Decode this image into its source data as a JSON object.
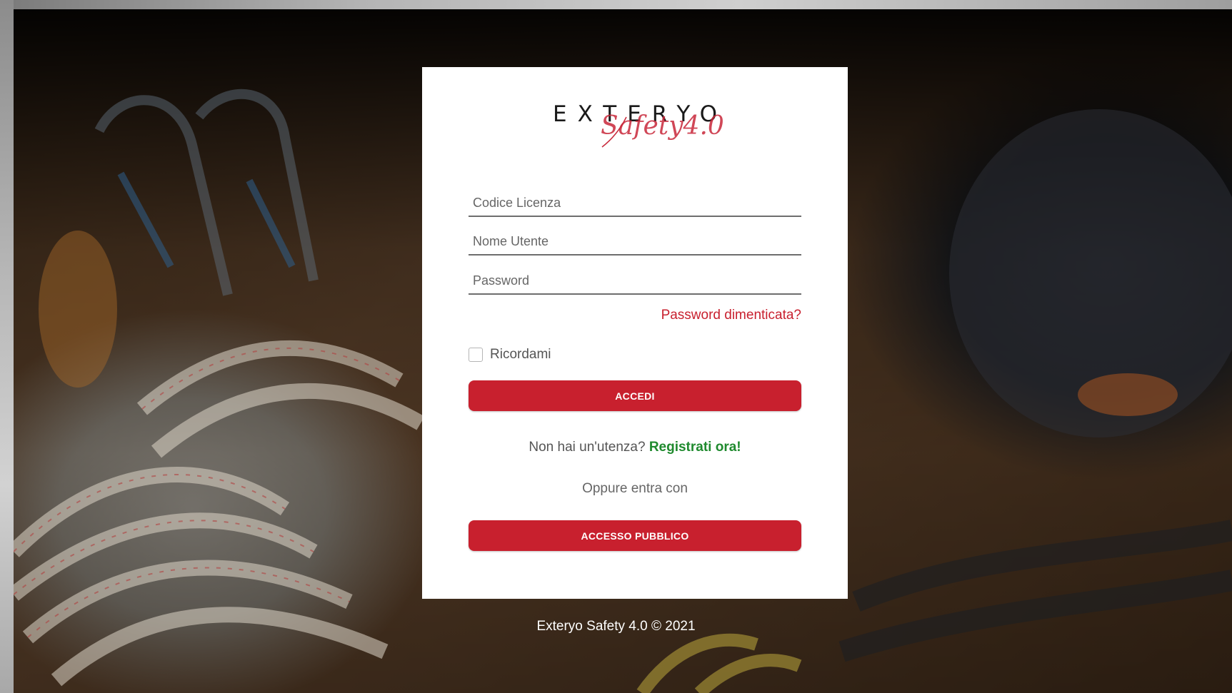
{
  "brand": {
    "logo_word": "EXTERYO",
    "logo_script": "Safety4.0",
    "accent_color": "#c8202e",
    "link_color": "#1f8a2e"
  },
  "login": {
    "license_placeholder": "Codice Licenza",
    "username_placeholder": "Nome Utente",
    "password_placeholder": "Password",
    "forgot_password": "Password dimenticata?",
    "remember_me": "Ricordami",
    "remember_checked": false,
    "submit_label": "ACCEDI",
    "no_account_text": "Non hai un'utenza?",
    "register_link": "Registrati ora!",
    "or_enter_with": "Oppure entra con",
    "public_access_label": "ACCESSO PUBBLICO"
  },
  "footer": {
    "copyright": "Exteryo Safety 4.0 © 2021"
  }
}
